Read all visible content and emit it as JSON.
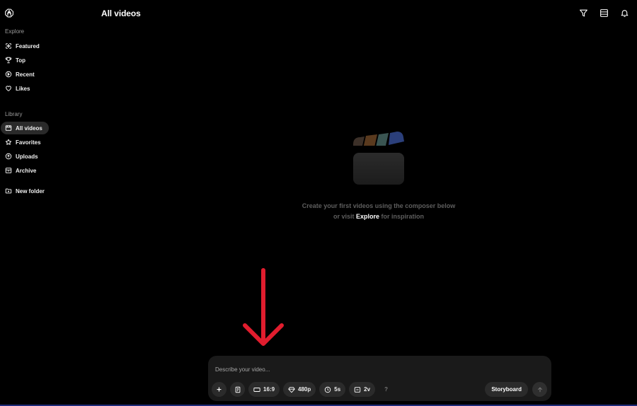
{
  "header": {
    "title": "All videos"
  },
  "sidebar": {
    "explore_label": "Explore",
    "explore_items": [
      {
        "label": "Featured",
        "icon": "featured-icon"
      },
      {
        "label": "Top",
        "icon": "trophy-icon"
      },
      {
        "label": "Recent",
        "icon": "recent-icon"
      },
      {
        "label": "Likes",
        "icon": "heart-icon"
      }
    ],
    "library_label": "Library",
    "library_items": [
      {
        "label": "All videos",
        "icon": "videos-icon",
        "active": true
      },
      {
        "label": "Favorites",
        "icon": "star-icon"
      },
      {
        "label": "Uploads",
        "icon": "upload-icon"
      },
      {
        "label": "Archive",
        "icon": "archive-icon"
      }
    ],
    "new_folder": {
      "label": "New folder",
      "icon": "folder-plus-icon"
    }
  },
  "empty_state": {
    "line1": "Create your first videos using the composer below",
    "line2_prefix": "or visit",
    "line2_link": "Explore",
    "line2_suffix": "for inspiration"
  },
  "composer": {
    "placeholder": "Describe your video...",
    "aspect_ratio": "16:9",
    "resolution": "480p",
    "duration": "5s",
    "variations": "2v",
    "help": "?",
    "storyboard_label": "Storyboard"
  },
  "colors": {
    "background": "#000000",
    "surface": "#1a1a1a",
    "chip": "#2b2b2b",
    "muted_text": "#5e5e5e",
    "arrow": "#e11d2e"
  }
}
